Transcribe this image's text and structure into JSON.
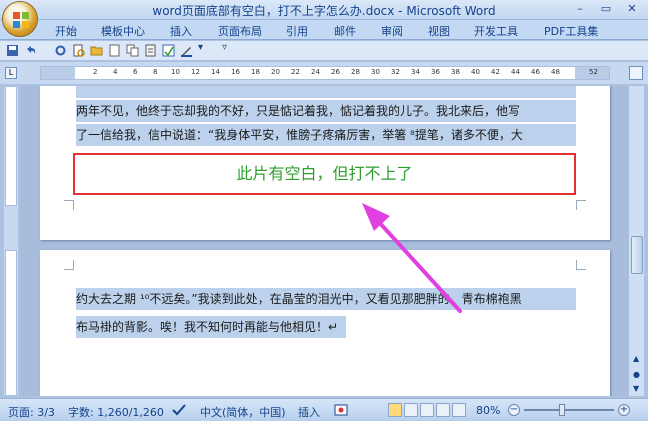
{
  "window": {
    "title": "word页面底部有空白，打不上字怎么办.docx - Microsoft Word",
    "controls": [
      "–",
      "▭",
      "✕"
    ]
  },
  "ribbon": {
    "tabs": [
      "开始",
      "模板中心",
      "插入",
      "页面布局",
      "引用",
      "邮件",
      "审阅",
      "视图",
      "开发工具",
      "PDF工具集"
    ]
  },
  "ruler": {
    "numbers": [
      "2",
      "4",
      "6",
      "8",
      "10",
      "12",
      "14",
      "16",
      "18",
      "20",
      "22",
      "24",
      "26",
      "28",
      "30",
      "32",
      "34",
      "36",
      "38",
      "40",
      "42",
      "44",
      "46",
      "48",
      "52"
    ]
  },
  "document": {
    "page1_lines": [
      "两年不见，他终于忘却我的不好，只是惦记着我，惦记着我的儿子。我北来后，他写",
      "了一信给我，信中说道：“我身体平安，惟膀子疼痛厉害，举箸 ⁸提笔，诸多不便，大"
    ],
    "annotation": "此片有空白，但打不上了",
    "page2_lines": [
      "约大去之期 ¹⁰不远矣。”我读到此处，在晶莹的泪光中，又看见那肥胖的、青布棉袍黑",
      "布马褂的背影。唉！我不知何时再能与他相见！↵"
    ]
  },
  "statusbar": {
    "page": "页面: 3/3",
    "words": "字数: 1,260/1,260",
    "language": "中文(简体，中国)",
    "insert_mode": "插入",
    "zoom": "80%"
  },
  "colors": {
    "highlight": "#bcd2ec",
    "annotation_text": "#2f9e2f",
    "annotation_border": "#e03030",
    "arrow": "#e040e0"
  }
}
